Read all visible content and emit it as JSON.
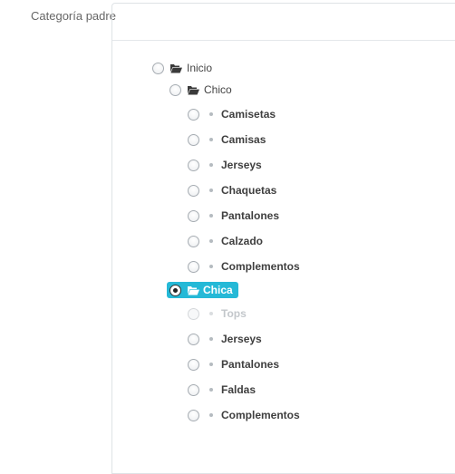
{
  "field": {
    "label": "Categoría padre"
  },
  "tree": {
    "root": {
      "label": "Inicio",
      "checked": false
    },
    "groups": [
      {
        "label": "Chico",
        "checked": false,
        "selected": false,
        "children": [
          {
            "label": "Camisetas",
            "disabled": false
          },
          {
            "label": "Camisas",
            "disabled": false
          },
          {
            "label": "Jerseys",
            "disabled": false
          },
          {
            "label": "Chaquetas",
            "disabled": false
          },
          {
            "label": "Pantalones",
            "disabled": false
          },
          {
            "label": "Calzado",
            "disabled": false
          },
          {
            "label": "Complementos",
            "disabled": false
          }
        ]
      },
      {
        "label": "Chica",
        "checked": true,
        "selected": true,
        "children": [
          {
            "label": "Tops",
            "disabled": true
          },
          {
            "label": "Jerseys",
            "disabled": false
          },
          {
            "label": "Pantalones",
            "disabled": false
          },
          {
            "label": "Faldas",
            "disabled": false
          },
          {
            "label": "Complementos",
            "disabled": false
          }
        ]
      }
    ]
  },
  "colors": {
    "selected_bg": "#25b9d7",
    "bullet": "#b5bbc0",
    "text": "#444444",
    "muted": "#c3c7cb"
  },
  "icons": {
    "folder": "folder-open-icon",
    "bullet": "bullet-icon"
  }
}
